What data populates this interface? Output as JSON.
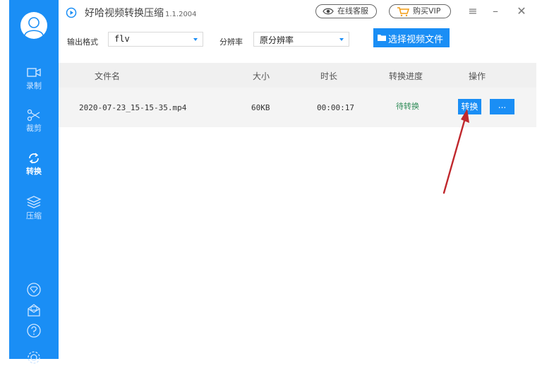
{
  "app": {
    "title": "好哈视频转换压缩",
    "version": "1.1.2004"
  },
  "topbar": {
    "service_label": "在线客服",
    "vip_label": "购买VIP"
  },
  "sidebar": {
    "items": [
      {
        "label": "录制",
        "icon": "video-record-icon"
      },
      {
        "label": "裁剪",
        "icon": "scissors-icon"
      },
      {
        "label": "转换",
        "icon": "convert-icon",
        "active": true
      },
      {
        "label": "压缩",
        "icon": "layers-icon"
      }
    ],
    "bottom_icons": [
      "diamond-icon",
      "mail-icon",
      "help-icon",
      "settings-icon"
    ]
  },
  "options": {
    "format_label": "输出格式",
    "format_value": "flv",
    "resolution_label": "分辨率",
    "resolution_value": "原分辨率",
    "pick_button": "选择视频文件"
  },
  "table": {
    "headers": [
      "文件名",
      "大小",
      "时长",
      "转换进度",
      "操作"
    ],
    "rows": [
      {
        "filename": "2020-07-23_15-15-35.mp4",
        "size": "60KB",
        "duration": "00:00:17",
        "status": "待转换",
        "action_convert": "转换",
        "action_more": "..."
      }
    ]
  },
  "colors": {
    "accent": "#1a8ef5",
    "status_pending": "#2e8b57",
    "annotation_arrow": "#c0282d"
  }
}
